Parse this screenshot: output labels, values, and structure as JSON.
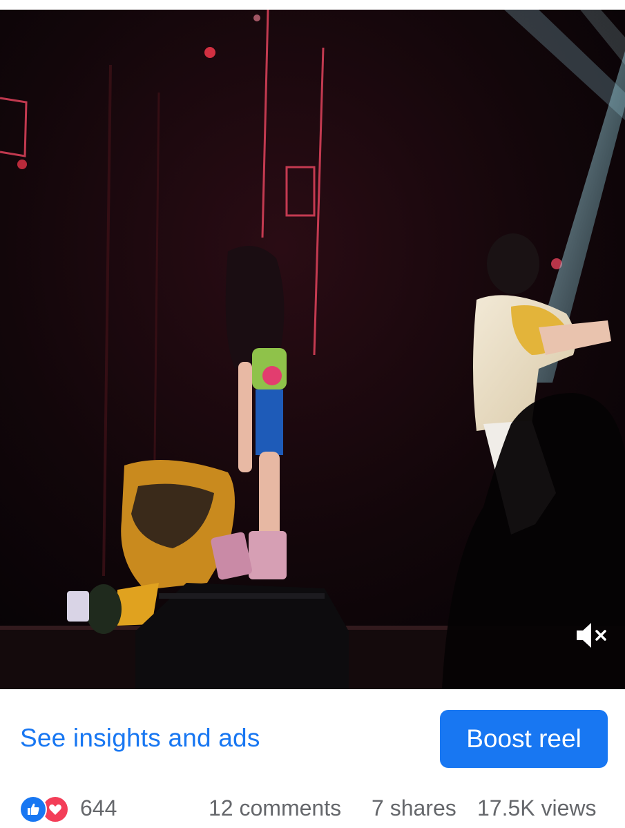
{
  "video": {
    "description_icon": "mute-icon",
    "muted": true
  },
  "actions": {
    "insights_label": "See insights and ads",
    "boost_label": "Boost reel"
  },
  "stats": {
    "reactions_count": "644",
    "reaction_icons": [
      "like-icon",
      "love-icon"
    ],
    "comments": "12 comments",
    "shares": "7 shares",
    "views": "17.5K views"
  },
  "colors": {
    "accent": "#1877f2",
    "love": "#f33e58",
    "muted_text": "#65676b"
  }
}
